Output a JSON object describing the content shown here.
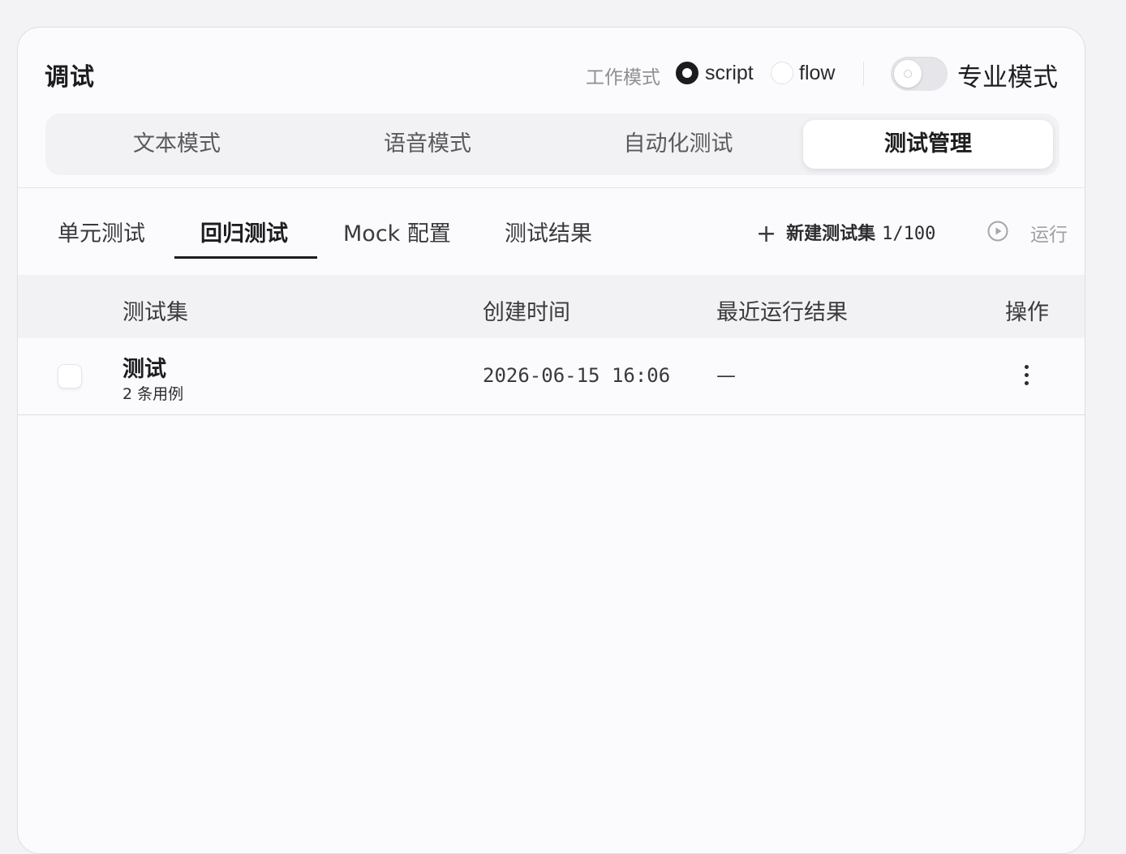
{
  "header": {
    "title": "调试",
    "work_mode_label": "工作模式",
    "modes": [
      {
        "label": "script",
        "selected": true
      },
      {
        "label": "flow",
        "selected": false
      }
    ],
    "pro_mode": {
      "label": "专业模式",
      "enabled": false
    }
  },
  "segments": [
    {
      "label": "文本模式",
      "active": false
    },
    {
      "label": "语音模式",
      "active": false
    },
    {
      "label": "自动化测试",
      "active": false
    },
    {
      "label": "测试管理",
      "active": true
    }
  ],
  "subtabs": [
    {
      "label": "单元测试",
      "active": false
    },
    {
      "label": "回归测试",
      "active": true
    },
    {
      "label": "Mock 配置",
      "active": false
    },
    {
      "label": "测试结果",
      "active": false
    }
  ],
  "actions": {
    "new_set_label": "新建测试集",
    "new_set_count": "1/100",
    "run_label": "运行"
  },
  "icons": {
    "add": "plus-icon",
    "run": "play-circle-icon",
    "more": "more-vertical-icon"
  },
  "table": {
    "columns": [
      "测试集",
      "创建时间",
      "最近运行结果",
      "操作"
    ],
    "rows": [
      {
        "name": "测试",
        "case_count": "2 条用例",
        "created": "2026-06-15 16:06",
        "last_result": "—"
      }
    ]
  },
  "colors": {
    "accent": "#1c1c1e",
    "muted": "#8e8e93",
    "panel_bg": "#fbfbfd",
    "header_bg": "#f2f2f5"
  }
}
